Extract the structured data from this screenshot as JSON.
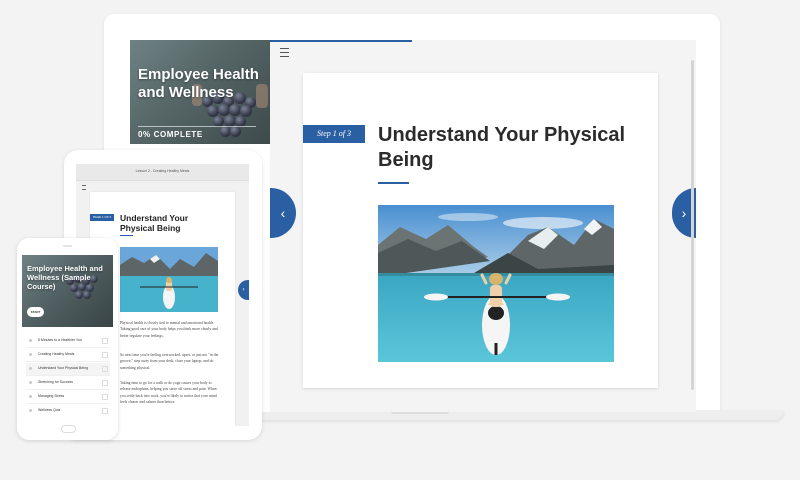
{
  "course": {
    "title": "Employee Health and Wellness",
    "phone_title": "Employee Health and Wellness (Sample Course)",
    "progress": "0% COMPLETE",
    "start_label": "START"
  },
  "lesson": {
    "step": "Step 1 of 3",
    "tablet_step": "PAGE 1 OF 3",
    "title": "Understand Your Physical Being",
    "tablet_header": "Lesson 2 - Creating Healthy Meals"
  },
  "tablet_paragraphs": [
    "Physical health is closely tied to mental and emotional health. Taking good care of your body helps you think more clearly and better regulate your feelings.",
    "So next time you're feeling overworked, upset, or just not \"in the groove,\" step away from your desk, close your laptop, and do something physical.",
    "Taking time to go for a walk or do yoga causes your body to release endorphins, helping you stave off stress and pain. When you settle back into work, you're likely to notice that your mind feels clearer and calmer than before."
  ],
  "phone_lessons": [
    "5 Minutes to a Healthier You",
    "Creating Healthy Meals",
    "Understand Your Physical Being",
    "Stretching for Success",
    "Managing Stress",
    "Wellness Quiz"
  ],
  "icons": {
    "menu": "hamburger-icon",
    "prev": "chevron-left-icon",
    "next": "chevron-right-icon"
  },
  "colors": {
    "accent": "#2b5fa4",
    "background": "#f3f3f3"
  }
}
